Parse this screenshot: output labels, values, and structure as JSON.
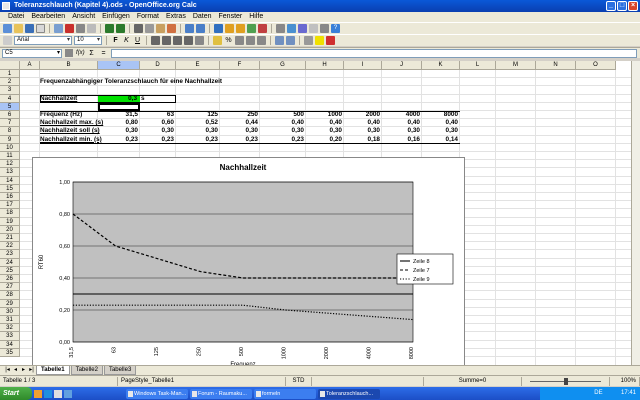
{
  "window": {
    "title": "Toleranzschlauch (Kapitel 4).ods - OpenOffice.org Calc"
  },
  "menu": [
    "Datei",
    "Bearbeiten",
    "Ansicht",
    "Einfügen",
    "Format",
    "Extras",
    "Daten",
    "Fenster",
    "Hilfe"
  ],
  "format_toolbar": {
    "font": "Arial",
    "size": "10"
  },
  "formula_bar": {
    "name_box": "C5",
    "content": ""
  },
  "columns": [
    "A",
    "B",
    "C",
    "D",
    "E",
    "F",
    "G",
    "H",
    "I",
    "J",
    "K",
    "L",
    "M",
    "N",
    "O"
  ],
  "rows": [
    "1",
    "2",
    "3",
    "4",
    "5",
    "6",
    "7",
    "8",
    "9",
    "10",
    "11",
    "12",
    "13",
    "14",
    "15",
    "16",
    "17",
    "18",
    "19",
    "20",
    "21",
    "22",
    "23",
    "24",
    "25",
    "26",
    "27",
    "28",
    "29",
    "30",
    "31",
    "32",
    "33",
    "34",
    "35"
  ],
  "sheet": {
    "heading": "Frequenzabhängiger Toleranzschlauch für eine Nachhallzeit",
    "r4_label": "Nachhallzeit",
    "r4_value": "0,3",
    "r4_unit": "s",
    "r6_label": "Frequenz (Hz)",
    "r6": [
      "31,5",
      "63",
      "125",
      "250",
      "500",
      "1000",
      "2000",
      "4000",
      "8000"
    ],
    "r7_label": "Nachhallzeit max. (s)",
    "r7": [
      "0,80",
      "0,60",
      "0,52",
      "0,44",
      "0,40",
      "0,40",
      "0,40",
      "0,40",
      "0,40"
    ],
    "r8_label": "Nachhallzeit soll (s)",
    "r8": [
      "0,30",
      "0,30",
      "0,30",
      "0,30",
      "0,30",
      "0,30",
      "0,30",
      "0,30",
      "0,30"
    ],
    "r9_label": "Nachhallzeit min. (s)",
    "r9": [
      "0,23",
      "0,23",
      "0,23",
      "0,23",
      "0,23",
      "0,20",
      "0,18",
      "0,16",
      "0,14"
    ]
  },
  "chart_data": {
    "type": "line",
    "title": "Nachhallzeit",
    "ylabel": "RT60",
    "xlabel": "Frequenz",
    "categories": [
      "31,5",
      "63",
      "125",
      "250",
      "500",
      "1000",
      "2000",
      "4000",
      "8000"
    ],
    "ylim": [
      0,
      1
    ],
    "yticks": [
      "0,00",
      "0,20",
      "0,40",
      "0,60",
      "0,80",
      "1,00"
    ],
    "grid": true,
    "legend_position": "right",
    "plot_bg": "#c0c0c0",
    "series": [
      {
        "name": "Zeile 8",
        "values": [
          0.3,
          0.3,
          0.3,
          0.3,
          0.3,
          0.3,
          0.3,
          0.3,
          0.3
        ],
        "dash": "solid"
      },
      {
        "name": "Zeile 7",
        "values": [
          0.8,
          0.6,
          0.52,
          0.44,
          0.4,
          0.4,
          0.4,
          0.4,
          0.4
        ],
        "dash": "dashed"
      },
      {
        "name": "Zeile 9",
        "values": [
          0.23,
          0.23,
          0.23,
          0.23,
          0.23,
          0.2,
          0.18,
          0.16,
          0.14
        ],
        "dash": "dotted"
      }
    ]
  },
  "sheet_tabs": [
    "Tabelle1",
    "Tabelle2",
    "Tabelle3"
  ],
  "status": {
    "sheet": "Tabelle 1 / 3",
    "style": "PageStyle_Tabelle1",
    "mode": "STD",
    "sum": "Summe=0",
    "zoom": "100%"
  },
  "taskbar": {
    "start": "Start",
    "tasks": [
      "Windows Task-Man...",
      "Forum - Raumaku...",
      "formeln",
      "Toleranzschlauch..."
    ],
    "lang": "DE",
    "clock": "17:41"
  },
  "colors": {
    "highlight": "#00e000",
    "selection": "#a9c4f5"
  }
}
